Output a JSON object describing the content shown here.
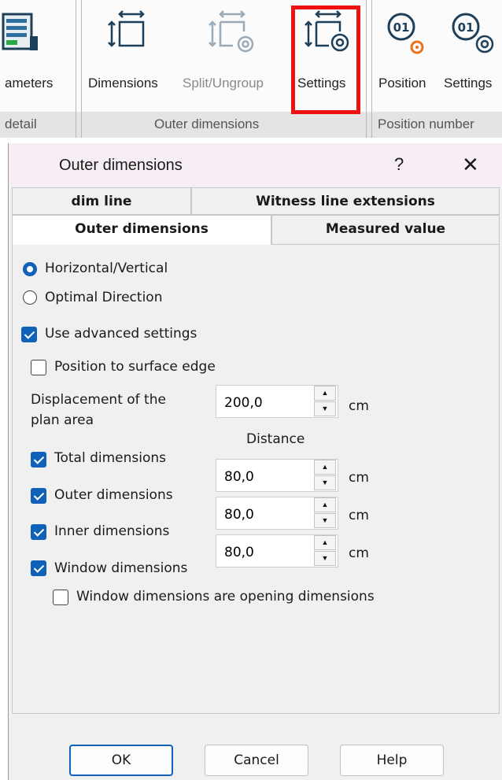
{
  "ribbon": {
    "buttons": [
      {
        "label": "ameters",
        "enabled": true,
        "icon": "parameters-icon"
      },
      {
        "label": "Dimensions",
        "enabled": true,
        "icon": "dimensions-icon"
      },
      {
        "label": "Split/Ungroup",
        "enabled": false,
        "icon": "split-ungroup-icon"
      },
      {
        "label": "Settings",
        "enabled": true,
        "icon": "dimension-settings-icon",
        "highlighted": true
      },
      {
        "label": "Position",
        "enabled": true,
        "icon": "position-number-icon"
      },
      {
        "label": "Settings",
        "enabled": true,
        "icon": "position-settings-icon"
      }
    ],
    "groups": [
      {
        "label": "detail"
      },
      {
        "label": "Outer dimensions"
      },
      {
        "label": "Position number"
      }
    ],
    "highlight_color": "#ee1111"
  },
  "dialog": {
    "title": "Outer dimensions",
    "help": "?",
    "close": "✕",
    "tabs_row1": [
      {
        "label": "dim line"
      },
      {
        "label": "Witness line extensions"
      }
    ],
    "tabs_row2": [
      {
        "label": "Outer dimensions",
        "active": true
      },
      {
        "label": "Measured value",
        "active": false
      }
    ],
    "direction": [
      {
        "label": "Horizontal/Vertical",
        "checked": true
      },
      {
        "label": "Optimal Direction",
        "checked": false
      }
    ],
    "use_advanced": {
      "label": "Use advanced settings",
      "checked": true
    },
    "position_surface": {
      "label": "Position to surface edge",
      "checked": false
    },
    "displacement": {
      "label_line1": "Displacement of the",
      "label_line2": "plan area",
      "value": "200,0",
      "unit": "cm"
    },
    "distance_header": "Distance",
    "dimension_types": [
      {
        "label": "Total dimensions",
        "checked": true
      },
      {
        "label": "Outer dimensions",
        "checked": true
      },
      {
        "label": "Inner dimensions",
        "checked": true
      },
      {
        "label": "Window dimensions",
        "checked": true
      }
    ],
    "distances": [
      {
        "value": "80,0",
        "unit": "cm"
      },
      {
        "value": "80,0",
        "unit": "cm"
      },
      {
        "value": "80,0",
        "unit": "cm"
      }
    ],
    "window_opening": {
      "label": "Window dimensions are opening dimensions",
      "checked": false
    },
    "buttons": {
      "ok": "OK",
      "cancel": "Cancel",
      "help": "Help"
    },
    "accent_color": "#0f62b8"
  }
}
